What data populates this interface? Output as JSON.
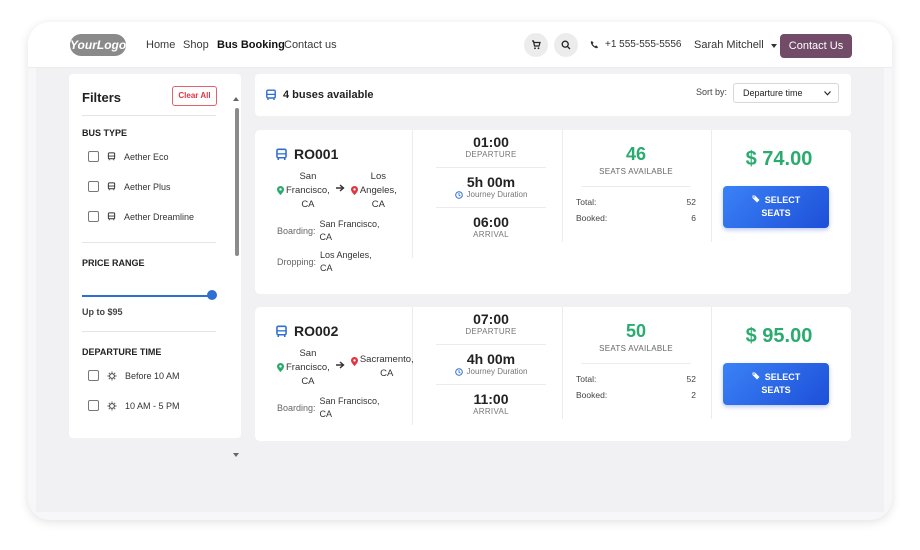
{
  "nav": {
    "logo": "YourLogo",
    "links": [
      "Home",
      "Shop",
      "Bus Booking",
      "Contact us"
    ],
    "phone": "+1 555-555-5556",
    "user": "Sarah Mitchell",
    "contact_button": "Contact Us"
  },
  "filters": {
    "title": "Filters",
    "clear_all": "Clear All",
    "bus_type_title": "BUS TYPE",
    "bus_types": [
      "Aether Eco",
      "Aether Plus",
      "Aether Dreamline"
    ],
    "price_title": "PRICE RANGE",
    "price_value": "Up to $95",
    "price_fraction": 1.0,
    "departure_title": "DEPARTURE TIME",
    "departure_options": [
      "Before 10 AM",
      "10 AM - 5 PM"
    ]
  },
  "results": {
    "count_text": "4 buses available",
    "sort_label": "Sort by:",
    "sort_value": "Departure time"
  },
  "buses": [
    {
      "id": "RO001",
      "from_lines": [
        "San",
        "Francisco,",
        "CA"
      ],
      "to_lines": [
        "Los",
        "Angeles,",
        "CA"
      ],
      "boarding_label": "Boarding:",
      "boarding_lines": [
        "San Francisco,",
        "CA"
      ],
      "dropping_label": "Dropping:",
      "dropping_lines": [
        "Los Angeles,",
        "CA"
      ],
      "departure_time": "01:00",
      "departure_label": "DEPARTURE",
      "duration": "5h 00m",
      "duration_label": "Journey Duration",
      "arrival_time": "06:00",
      "arrival_label": "ARRIVAL",
      "seats_available": "46",
      "seats_label": "SEATS AVAILABLE",
      "total_label": "Total:",
      "total": "52",
      "booked_label": "Booked:",
      "booked": "6",
      "price": "$ 74.00",
      "select_line1": "SELECT",
      "select_line2": "SEATS"
    },
    {
      "id": "RO002",
      "from_lines": [
        "San",
        "Francisco,",
        "CA"
      ],
      "to_lines": [
        "Sacramento,",
        "CA"
      ],
      "boarding_label": "Boarding:",
      "boarding_lines": [
        "San Francisco,",
        "CA"
      ],
      "departure_time": "07:00",
      "departure_label": "DEPARTURE",
      "duration": "4h 00m",
      "duration_label": "Journey Duration",
      "arrival_time": "11:00",
      "arrival_label": "ARRIVAL",
      "seats_available": "50",
      "seats_label": "SEATS AVAILABLE",
      "total_label": "Total:",
      "total": "52",
      "booked_label": "Booked:",
      "booked": "2",
      "price": "$ 95.00",
      "select_line1": "SELECT",
      "select_line2": "SEATS"
    }
  ],
  "colors": {
    "accent": "#714b67",
    "primary": "#2f6fd1",
    "success": "#2aab6f",
    "danger": "#e03640"
  },
  "icons": [
    "cart-icon",
    "search-icon",
    "phone-icon",
    "caret-down-icon",
    "bus-icon",
    "location-pin-icon",
    "arrow-right-icon",
    "clock-icon",
    "ticket-icon",
    "sun-icon"
  ]
}
